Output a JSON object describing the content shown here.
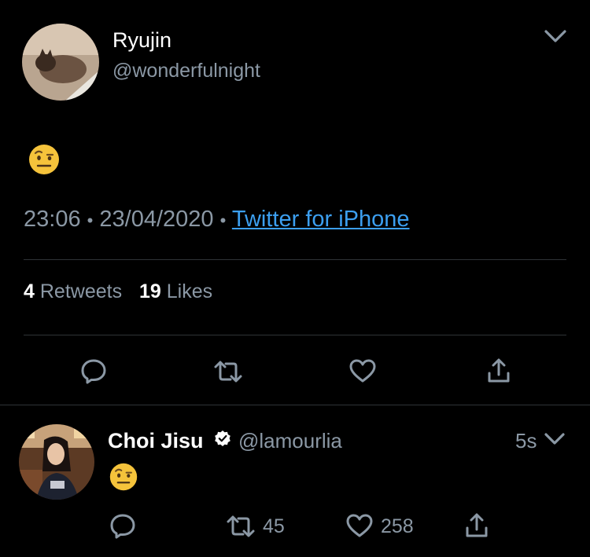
{
  "main_tweet": {
    "author_name": "Ryujin",
    "author_handle": "@wonderfulnight",
    "emoji": "face-with-raised-eyebrow",
    "time": "23:06",
    "separator": "•",
    "date": "23/04/2020",
    "source": "Twitter for iPhone",
    "retweet_count": "4",
    "retweet_label": "Retweets",
    "like_count": "19",
    "like_label": "Likes",
    "actions": [
      "reply-icon",
      "retweet-icon",
      "like-icon",
      "share-icon"
    ]
  },
  "reply_tweet": {
    "author_name": "Choi Jisu",
    "author_handle": "@lamourlia",
    "verified": true,
    "age": "5s",
    "emoji": "face-with-raised-eyebrow",
    "retweet_count": "45",
    "like_count": "258"
  },
  "colors": {
    "background": "#000000",
    "muted_text": "#8b98a5",
    "link": "#3c9ff0",
    "divider": "#2f3336"
  }
}
